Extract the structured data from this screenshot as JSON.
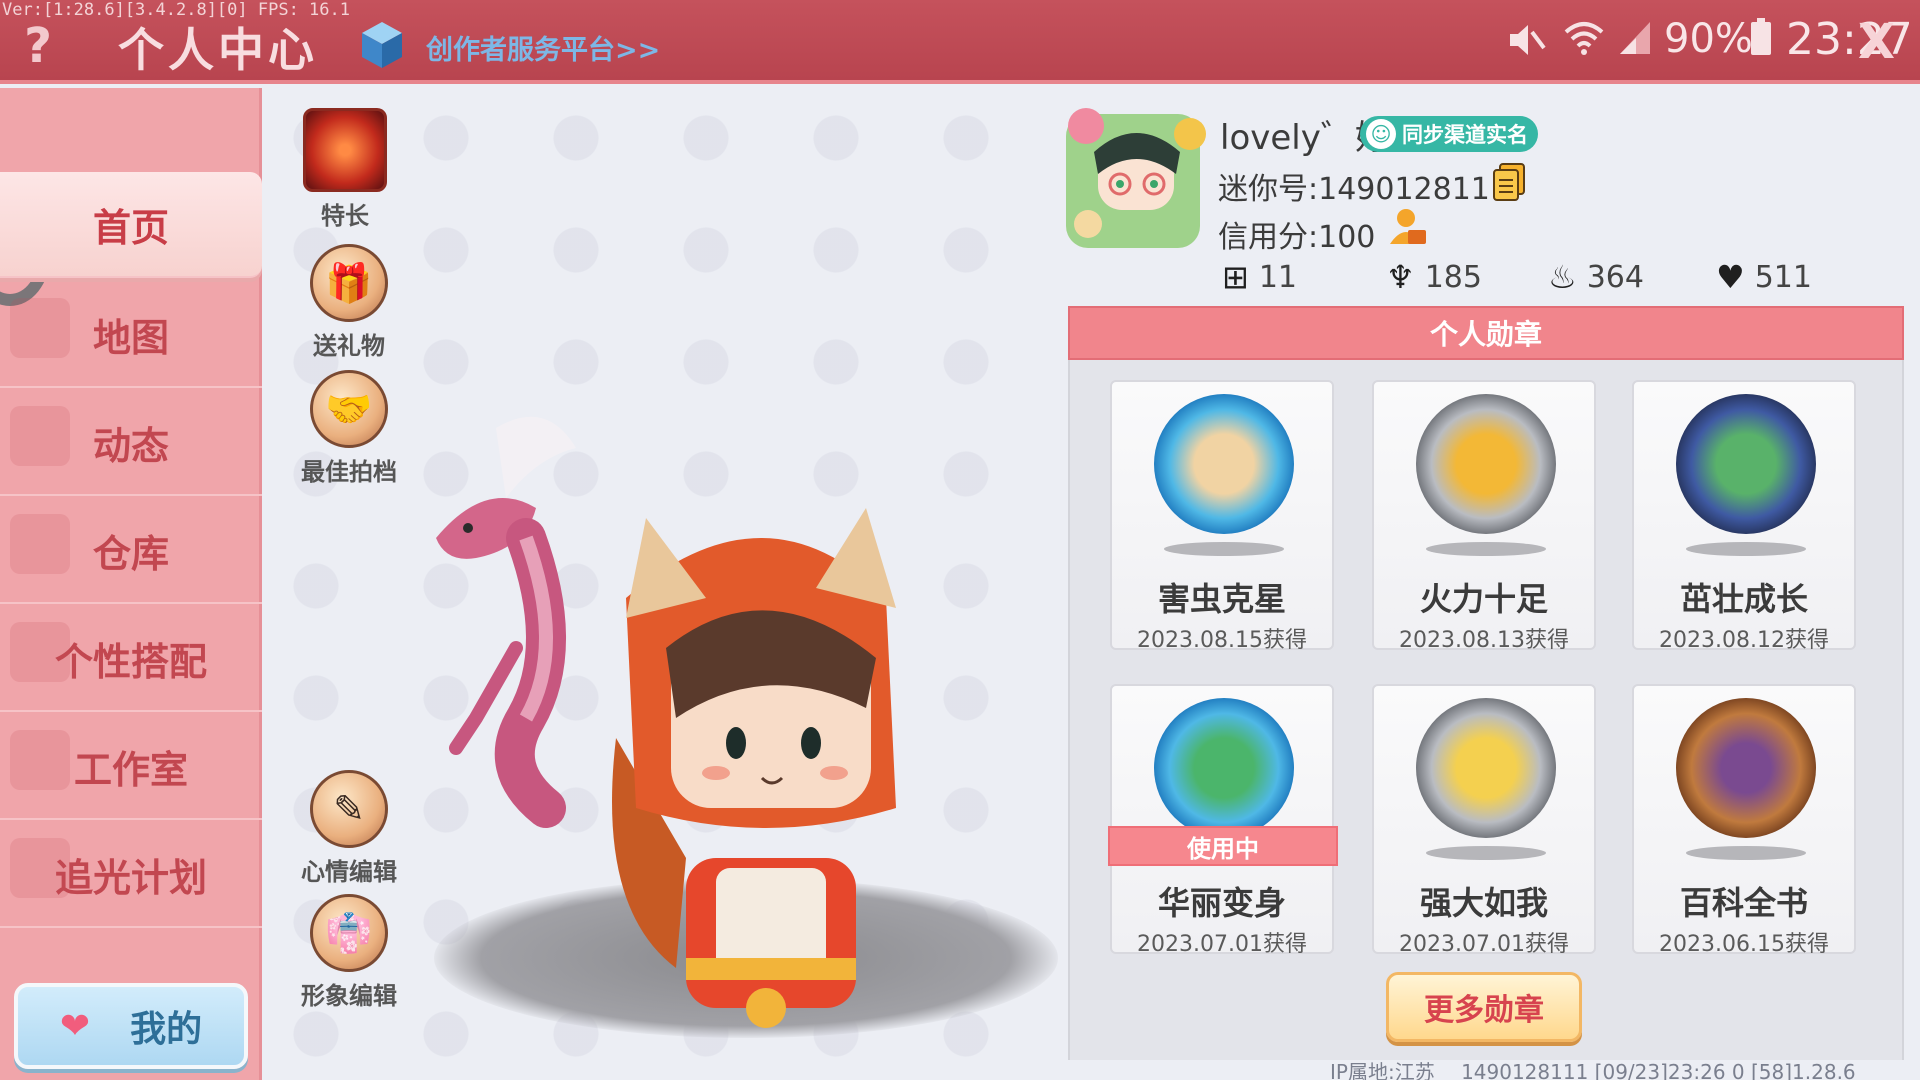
{
  "topbar": {
    "version": "Ver:[1:28.6][3.4.2.8][0] FPS: 16.1",
    "help_glyph": "?",
    "title": "个人中心",
    "platform_link": "创作者服务平台>>",
    "battery_pct": "90%",
    "time": "23:27",
    "close_glyph": "X"
  },
  "sidebar": {
    "items": [
      {
        "label": "首页",
        "active": true
      },
      {
        "label": "地图"
      },
      {
        "label": "动态"
      },
      {
        "label": "仓库"
      },
      {
        "label": "个性搭配"
      },
      {
        "label": "工作室"
      },
      {
        "label": "追光计划"
      }
    ],
    "mine_label": "我的"
  },
  "tools": [
    {
      "label": "特长",
      "icon": "fire-spirit-icon"
    },
    {
      "label": "送礼物",
      "icon": "gift-icon"
    },
    {
      "label": "最佳拍档",
      "icon": "handshake-icon"
    },
    {
      "label": "心情编辑",
      "icon": "edit-icon"
    },
    {
      "label": "形象编辑",
      "icon": "costume-icon"
    }
  ],
  "profile": {
    "username": "lovely゛妤",
    "realname_badge": "同步渠道实名",
    "mini_id": "迷你号:1490128111",
    "credit": "信用分:100",
    "stats": [
      {
        "icon": "plus-box-icon",
        "value": "11"
      },
      {
        "icon": "trophy-cup-icon",
        "value": "185"
      },
      {
        "icon": "flame-icon",
        "value": "364"
      },
      {
        "icon": "heart-icon",
        "value": "511"
      }
    ]
  },
  "medals": {
    "header": "个人勋章",
    "items": [
      {
        "name": "害虫克星",
        "date": "2023.08.15获得",
        "color": "#4fb8e6"
      },
      {
        "name": "火力十足",
        "date": "2023.08.13获得",
        "color": "#9fa3aa"
      },
      {
        "name": "茁壮成长",
        "date": "2023.08.12获得",
        "color": "#3f5aa3"
      },
      {
        "name": "华丽变身",
        "date": "2023.07.01获得",
        "color": "#4fb8e6",
        "in_use": "使用中"
      },
      {
        "name": "强大如我",
        "date": "2023.07.01获得",
        "color": "#9fa3aa"
      },
      {
        "name": "百科全书",
        "date": "2023.06.15获得",
        "color": "#b8743c"
      }
    ],
    "more_label": "更多勋章"
  },
  "footer": {
    "ip": "IP属地:江苏",
    "id": "1490128111",
    "log": "[09/23]23:26 0  [58]1.28.6"
  },
  "colors": {
    "accent": "#c5525c",
    "sidebar": "#f0a5aa",
    "badge": "#36b7a5"
  }
}
